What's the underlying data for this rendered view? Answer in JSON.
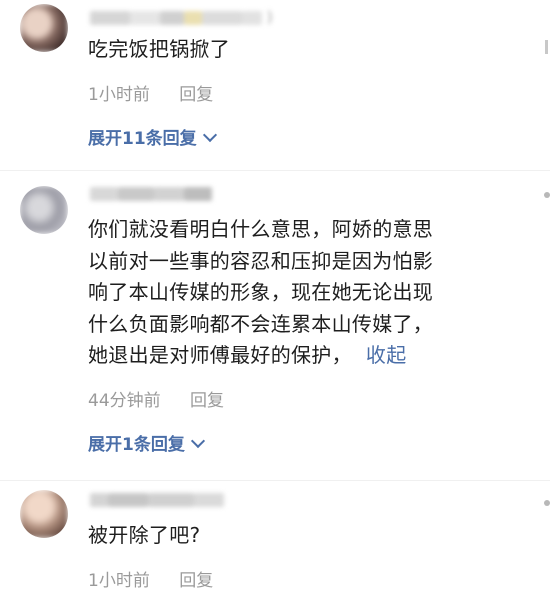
{
  "comments": [
    {
      "username": "",
      "name_suffix": ")",
      "body": "吃完饭把锅掀了",
      "time": "1小时前",
      "reply_label": "回复",
      "expand_label": "展开11条回复"
    },
    {
      "username": "",
      "body_lines": [
        "你们就没看明白什么意思，阿娇的意思",
        "以前对一些事的容忍和压抑是因为怕影",
        "响了本山传媒的形象，现在她无论出现",
        "什么负面影响都不会连累本山传媒了，",
        "她退出是对师傅最好的保护，"
      ],
      "collapse_label": "收起",
      "time": "44分钟前",
      "reply_label": "回复",
      "expand_label": "展开1条回复"
    },
    {
      "username": "",
      "body": "被开除了吧?",
      "time": "1小时前",
      "reply_label": "回复"
    }
  ]
}
